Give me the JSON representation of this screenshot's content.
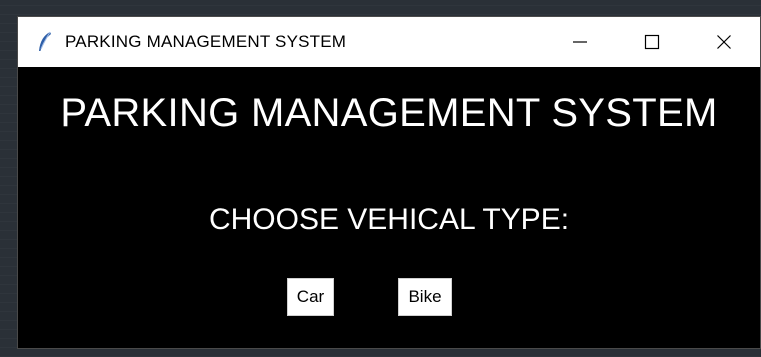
{
  "window": {
    "title": "PARKING MANAGEMENT SYSTEM",
    "app_icon": "feather-icon",
    "controls": [
      "minimize-icon",
      "maximize-icon",
      "close-icon"
    ]
  },
  "main": {
    "heading": "PARKING MANAGEMENT SYSTEM",
    "prompt": "CHOOSE VEHICAL TYPE:",
    "buttons": {
      "car_label": "Car",
      "bike_label": "Bike"
    }
  },
  "colors": {
    "window_background": "#000000",
    "titlebar_background": "#ffffff",
    "text": "#ffffff",
    "button_background": "#ffffff",
    "button_text": "#000000"
  }
}
